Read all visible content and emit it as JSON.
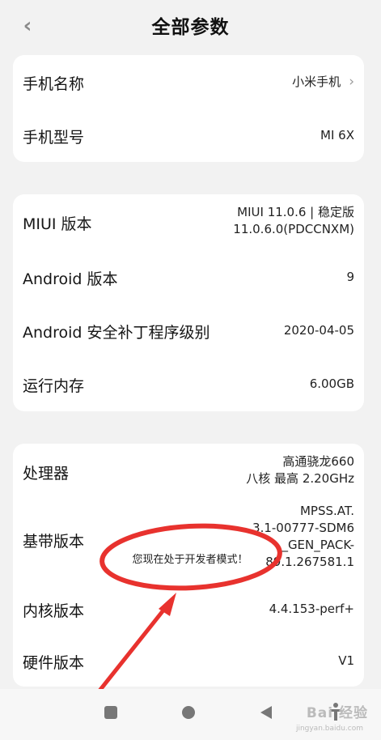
{
  "header": {
    "title": "全部参数",
    "back_glyph": "‹"
  },
  "cards": [
    {
      "rows": [
        {
          "label": "手机名称",
          "value": "小米手机",
          "chevron": "›"
        },
        {
          "label": "手机型号",
          "value": "MI 6X"
        }
      ]
    },
    {
      "rows": [
        {
          "label": "MIUI 版本",
          "value_lines": [
            "MIUI 11.0.6 | 稳定版",
            "11.0.6.0(PDCCNXM)"
          ]
        },
        {
          "label": "Android 版本",
          "value": "9"
        },
        {
          "label": "Android 安全补丁程序级别",
          "value": "2020-04-05"
        },
        {
          "label": "运行内存",
          "value": "6.00GB"
        }
      ]
    },
    {
      "rows": [
        {
          "label": "处理器",
          "value_lines": [
            "高通骁龙660",
            "八核 最高 2.20GHz"
          ]
        },
        {
          "label": "基带版本",
          "value_lines": [
            "MPSS.AT.",
            "3.1-00777-SDM6",
            "_GEN_PACK-",
            "89.1.267581.1"
          ]
        },
        {
          "label": "内核版本",
          "value": "4.4.153-perf+"
        },
        {
          "label": "硬件版本",
          "value": "V1"
        }
      ]
    }
  ],
  "toast": {
    "text": "您现在处于开发者模式！"
  },
  "annotation": {
    "color": "#e8322e"
  },
  "navbar": {
    "buttons": [
      "square-icon",
      "circle-icon",
      "triangle-icon"
    ]
  },
  "watermark": {
    "text": "Bai 经验",
    "sub": "jingyan.baidu.com"
  }
}
